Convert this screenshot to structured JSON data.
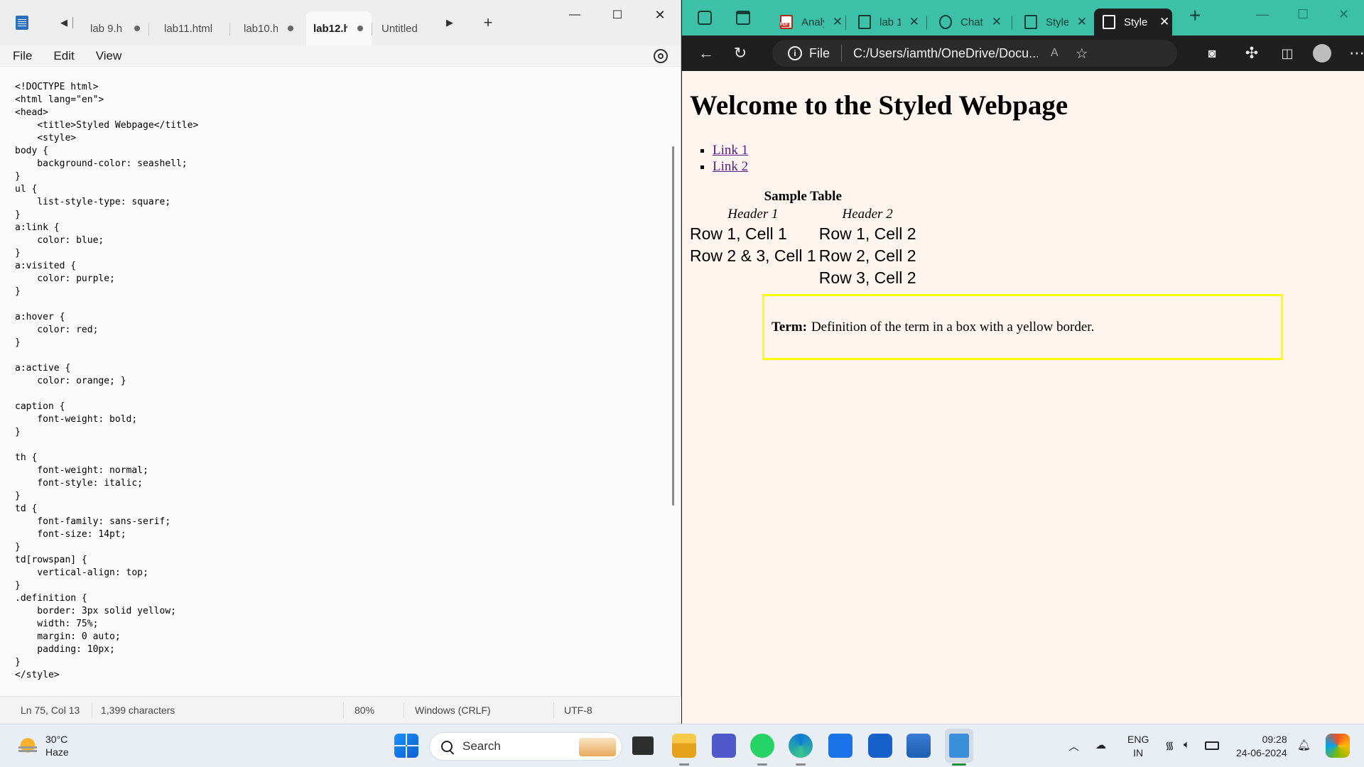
{
  "notepad": {
    "tabs": [
      {
        "label": "lab 9.h",
        "dirty": true
      },
      {
        "label": "lab11.html",
        "dirty": false
      },
      {
        "label": "lab10.h",
        "dirty": true
      },
      {
        "label": "lab12.h",
        "dirty": true,
        "active": true
      },
      {
        "label": "Untitled",
        "dirty": false
      }
    ],
    "menu": {
      "file": "File",
      "edit": "Edit",
      "view": "View"
    },
    "code": "<!DOCTYPE html>\n<html lang=\"en\">\n<head>\n    <title>Styled Webpage</title>\n    <style>\nbody {\n    background-color: seashell;\n}\nul {\n    list-style-type: square;\n}\na:link {\n    color: blue;\n}\na:visited {\n    color: purple;\n}\n\na:hover {\n    color: red;\n}\n\na:active {\n    color: orange; }\n\ncaption {\n    font-weight: bold;\n}\n\nth {\n    font-weight: normal;\n    font-style: italic;\n}\ntd {\n    font-family: sans-serif;\n    font-size: 14pt;\n}\ntd[rowspan] {\n    vertical-align: top;\n}\n.definition {\n    border: 3px solid yellow;\n    width: 75%;\n    margin: 0 auto;\n    padding: 10px;\n}\n</style>",
    "status": {
      "position": "Ln 75, Col 13",
      "chars": "1,399 characters",
      "zoom": "80%",
      "line_ending": "Windows (CRLF)",
      "encoding": "UTF-8"
    }
  },
  "edge": {
    "tabs": [
      {
        "label": "Analy",
        "icon": "pdf-icon"
      },
      {
        "label": "lab 1(",
        "icon": "page-icon"
      },
      {
        "label": "Chat(",
        "icon": "chatgpt-icon"
      },
      {
        "label": "Style",
        "icon": "page-icon"
      },
      {
        "label": "Style",
        "icon": "page-icon",
        "active": true
      }
    ],
    "address": {
      "protocol": "File",
      "url": "C:/Users/iamth/OneDrive/Docu..."
    },
    "page": {
      "heading": "Welcome to the Styled Webpage",
      "links": [
        "Link 1",
        "Link 2"
      ],
      "table": {
        "caption": "Sample Table",
        "headers": [
          "Header 1",
          "Header 2"
        ],
        "rows": [
          [
            "Row 1, Cell 1",
            "Row 1, Cell 2"
          ],
          [
            "Row 2 & 3, Cell 1",
            "Row 2, Cell 2"
          ],
          [
            "",
            "Row 3, Cell 2"
          ]
        ]
      },
      "definition": {
        "term": "Term:",
        "text": "Definition of the term in a box with a yellow border."
      }
    },
    "colors": {
      "tabbar": "#3cc0a8",
      "toolbar": "#1f1f1f",
      "page_bg": "#fff5ee",
      "visited_link": "#551a8b",
      "def_border": "#ffff00"
    }
  },
  "taskbar": {
    "weather": {
      "temp": "30°C",
      "desc": "Haze"
    },
    "search_placeholder": "Search",
    "lang": {
      "line1": "ENG",
      "line2": "IN"
    },
    "clock": {
      "time": "09:28",
      "date": "24-06-2024"
    }
  }
}
